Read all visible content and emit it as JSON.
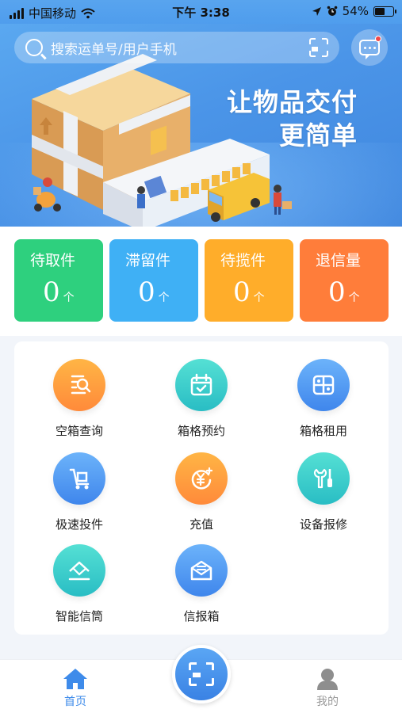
{
  "status_bar": {
    "carrier": "中国移动",
    "time": "下午 3:38",
    "battery": "54%",
    "battery_level": 0.54,
    "icons": [
      "signal-icon",
      "wifi-icon",
      "location-arrow-icon",
      "alarm-icon",
      "battery-icon"
    ]
  },
  "header": {
    "search_placeholder": "搜索运单号/用户手机",
    "scan_icon": "scan-icon",
    "message_icon": "message-icon",
    "has_unread": true
  },
  "banner": {
    "slogan_line1": "让物品交付",
    "slogan_line2": "更简单"
  },
  "stats": [
    {
      "label": "待取件",
      "value": "0",
      "unit": "个",
      "color": "#2ed07e"
    },
    {
      "label": "滞留件",
      "value": "0",
      "unit": "个",
      "color": "#3fb0f5"
    },
    {
      "label": "待揽件",
      "value": "0",
      "unit": "个",
      "color": "#ffad2a"
    },
    {
      "label": "退信量",
      "value": "0",
      "unit": "个",
      "color": "#ff7d3a"
    }
  ],
  "functions": [
    {
      "label": "空箱查询",
      "icon": "box-search-icon",
      "color": "orange"
    },
    {
      "label": "箱格预约",
      "icon": "calendar-check-icon",
      "color": "teal"
    },
    {
      "label": "箱格租用",
      "icon": "locker-grid-icon",
      "color": "blue"
    },
    {
      "label": "极速投件",
      "icon": "hand-truck-icon",
      "color": "blue"
    },
    {
      "label": "充值",
      "icon": "yuan-coin-icon",
      "color": "orange"
    },
    {
      "label": "设备报修",
      "icon": "wrench-screwdriver-icon",
      "color": "teal"
    },
    {
      "label": "智能信筒",
      "icon": "mailbox-slot-icon",
      "color": "teal"
    },
    {
      "label": "信报箱",
      "icon": "envelope-icon",
      "color": "blue"
    }
  ],
  "tabbar": {
    "home_label": "首页",
    "me_label": "我的",
    "active_tab": "首页",
    "accent": "#3e8bea",
    "scan_icon": "scan-icon"
  }
}
